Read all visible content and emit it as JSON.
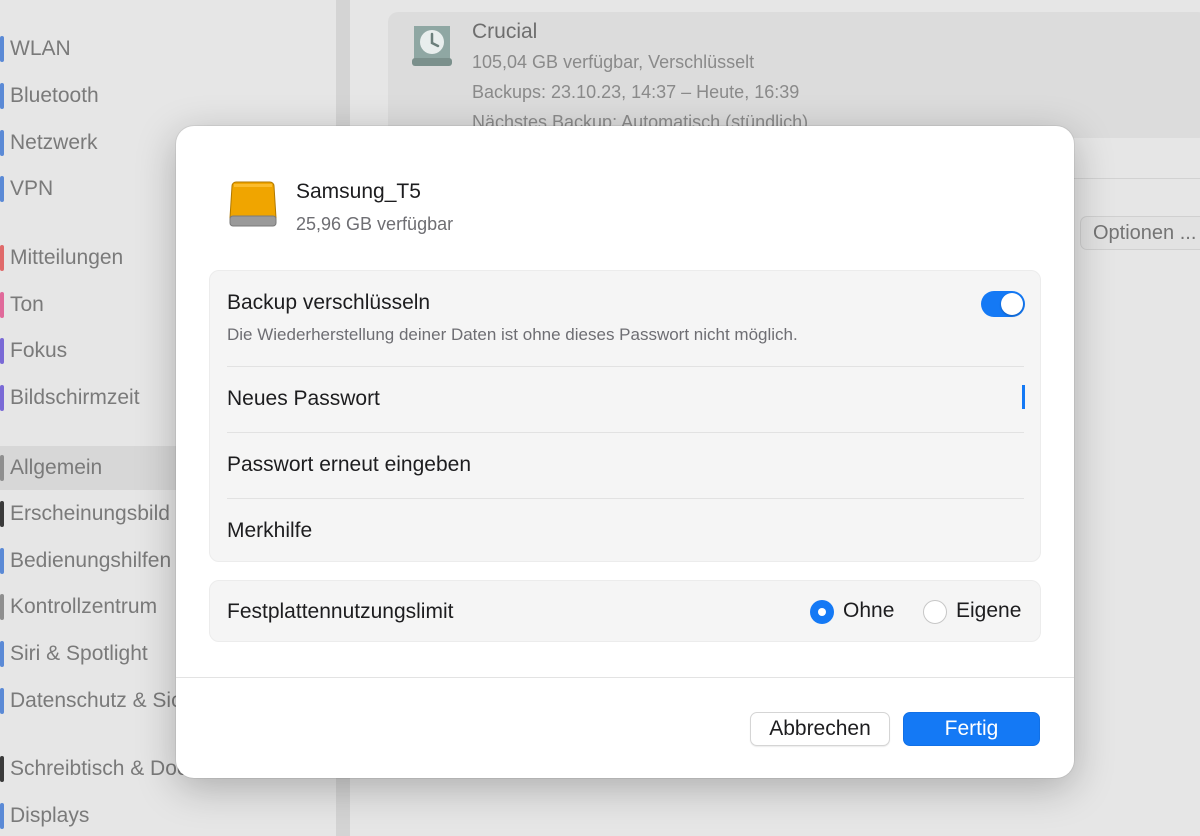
{
  "sidebar": {
    "items": [
      {
        "label": "WLAN",
        "color": "#5b8ad6"
      },
      {
        "label": "Bluetooth",
        "color": "#5b8ad6"
      },
      {
        "label": "Netzwerk",
        "color": "#5b8ad6"
      },
      {
        "label": "VPN",
        "color": "#5b8ad6"
      },
      {
        "label": "Mitteilungen",
        "color": "#e06a6a"
      },
      {
        "label": "Ton",
        "color": "#e06a9a"
      },
      {
        "label": "Fokus",
        "color": "#7a6ad6"
      },
      {
        "label": "Bildschirmzeit",
        "color": "#7a6ad6"
      },
      {
        "label": "Allgemein",
        "color": "#8f8f8f",
        "selected": true
      },
      {
        "label": "Erscheinungsbild",
        "color": "#3a3a3a"
      },
      {
        "label": "Bedienungshilfen",
        "color": "#5b8ad6"
      },
      {
        "label": "Kontrollzentrum",
        "color": "#8f8f8f"
      },
      {
        "label": "Siri & Spotlight",
        "color": "#5b8ad6"
      },
      {
        "label": "Datenschutz & Sicherheit",
        "color": "#5b8ad6"
      },
      {
        "label": "Schreibtisch & Dock",
        "color": "#3a3a3a"
      },
      {
        "label": "Displays",
        "color": "#5b8ad6"
      }
    ]
  },
  "background": {
    "disk": {
      "name": "Crucial",
      "available": "105,04 GB verfügbar, Verschlüsselt",
      "backups": "Backups: 23.10.23, 14:37 – Heute, 16:39",
      "next_backup": "Nächstes Backup: Automatisch (stündlich)"
    },
    "options_label": "Optionen ..."
  },
  "dialog": {
    "drive": {
      "name": "Samsung_T5",
      "available": "25,96 GB verfügbar",
      "icon": "external-drive-icon"
    },
    "encrypt": {
      "label": "Backup verschlüsseln",
      "description": "Die Wiederherstellung deiner Daten ist ohne dieses Passwort nicht möglich.",
      "enabled": true
    },
    "new_password": {
      "label": "Neues Passwort",
      "value": ""
    },
    "confirm_password": {
      "label": "Passwort erneut eingeben",
      "value": ""
    },
    "hint": {
      "label": "Merkhilfe",
      "value": ""
    },
    "disk_limit": {
      "label": "Festplattennutzungslimit",
      "options": [
        "Ohne",
        "Eigene"
      ],
      "selected": "Ohne"
    },
    "buttons": {
      "cancel": "Abbrechen",
      "done": "Fertig"
    }
  },
  "colors": {
    "accent": "#1479f5"
  }
}
